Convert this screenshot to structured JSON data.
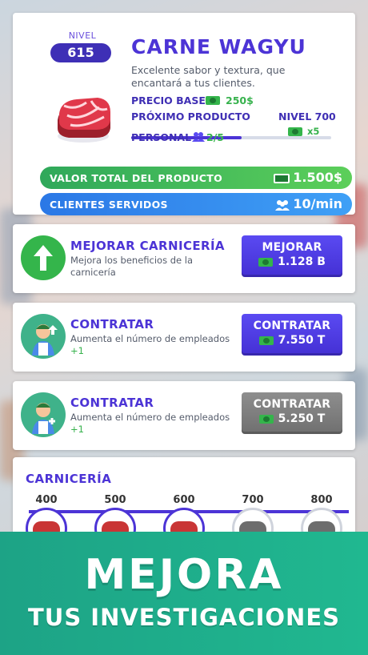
{
  "product": {
    "level_label": "NIVEL",
    "level_value": "615",
    "title": "CARNE WAGYU",
    "description": "Excelente sabor y textura, que encantará a tus clientes.",
    "base_price_label": "PRECIO BASE",
    "base_price_value": "250$",
    "next_product_label": "PRÓXIMO PRODUCTO",
    "next_level_label": "NIVEL 700",
    "next_progress": 0.55,
    "personal_label": "PERSONAL",
    "personal_value": "2/5",
    "multiplier": "x5",
    "total_value_label": "VALOR TOTAL DEL PRODUCTO",
    "total_value": "1.500$",
    "clients_label": "CLIENTES SERVIDOS",
    "clients_value": "10/min"
  },
  "upgrades": [
    {
      "title": "MEJORAR CARNICERÍA",
      "desc": "Mejora los beneficios de la carnicería",
      "button_label": "MEJORAR",
      "cost": "1.128 B",
      "icon": "arrow-up-icon"
    },
    {
      "title": "CONTRATAR",
      "desc": "Aumenta el número de empleados",
      "plus": "+1",
      "button_label": "CONTRATAR",
      "cost": "7.550 T",
      "icon": "worker-icon"
    },
    {
      "title": "CONTRATAR",
      "desc": "Aumenta el número de empleados",
      "plus": "+1",
      "button_label": "CONTRATAR",
      "cost": "5.250 T",
      "icon": "worker-icon"
    }
  ],
  "carniceria": {
    "title": "CARNICERÍA",
    "milestones": [
      "400",
      "500",
      "600",
      "700",
      "800"
    ]
  },
  "banner": {
    "line1": "MEJORA",
    "line2": "TUS INVESTIGACIONES"
  },
  "colors": {
    "accent": "#4c34d6",
    "green": "#37b24d",
    "blue": "#2b78e6",
    "banner": "#1da386"
  }
}
